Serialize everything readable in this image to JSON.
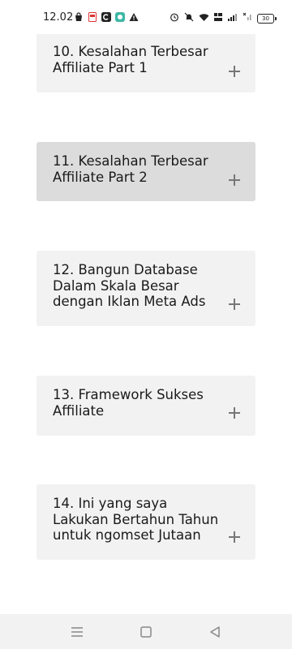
{
  "status_bar": {
    "time": "12.02",
    "battery_level": "30",
    "left_icons": [
      "shopping-bag-icon",
      "pdf-icon",
      "c-app-icon",
      "chat-icon",
      "warning-icon"
    ],
    "right_icons": [
      "alarm-icon",
      "mute-icon",
      "wifi-icon",
      "volte-icon",
      "signal-icon",
      "signal-x-icon",
      "battery-icon"
    ]
  },
  "lessons": [
    {
      "title": "10. Kesalahan Terbesar Affiliate Part 1",
      "expand_icon": "plus-icon"
    },
    {
      "title": "11. Kesalahan Terbesar Affiliate Part 2",
      "expand_icon": "plus-icon",
      "state": "pressed"
    },
    {
      "title": "12. Bangun Database Dalam Skala Besar dengan Iklan Meta Ads",
      "expand_icon": "plus-icon"
    },
    {
      "title": "13. Framework Sukses Affiliate",
      "expand_icon": "plus-icon"
    },
    {
      "title": "14. Ini yang saya Lakukan Bertahun Tahun untuk ngomset Jutaan",
      "expand_icon": "plus-icon"
    }
  ],
  "nav_bar": {
    "buttons": [
      "menu-icon",
      "home-icon",
      "back-icon"
    ]
  },
  "colors": {
    "card_background": "#f2f2f2",
    "card_pressed_background": "#dcdcdc",
    "plus_icon": "#777777",
    "nav_background": "#f2f2f2"
  }
}
